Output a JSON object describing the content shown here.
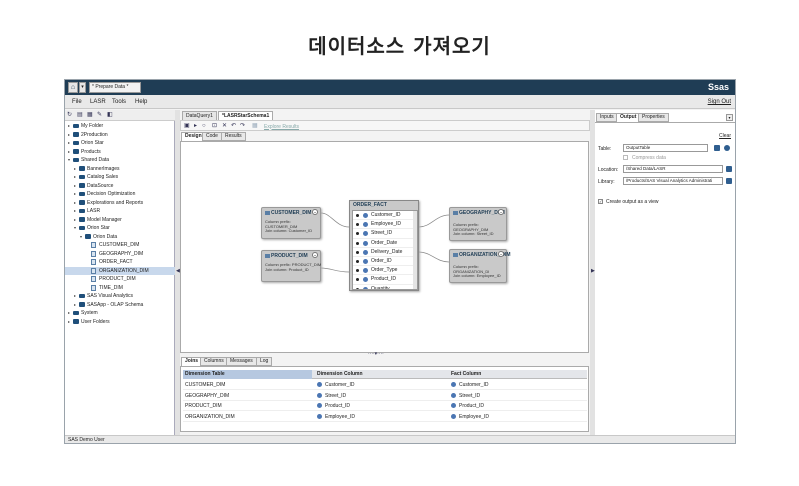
{
  "page_title": "데이터소스 가져오기",
  "topbar": {
    "app_selector": "* Prepare Data *",
    "brand": "Ssas"
  },
  "menu": {
    "items": [
      "File",
      "LASR",
      "Tools",
      "Help"
    ],
    "sign_out": "Sign Out"
  },
  "left_panel": {
    "tree": [
      {
        "label": "My Folder",
        "level": 0,
        "type": "folder",
        "expanded": false
      },
      {
        "label": "2Production",
        "level": 0,
        "type": "folder",
        "expanded": false
      },
      {
        "label": "Orion Star",
        "level": 0,
        "type": "folder",
        "expanded": false
      },
      {
        "label": "Products",
        "level": 0,
        "type": "folder",
        "expanded": false
      },
      {
        "label": "Shared Data",
        "level": 0,
        "type": "folder",
        "expanded": true
      },
      {
        "label": "BannerImages",
        "level": 1,
        "type": "folder",
        "expanded": false
      },
      {
        "label": "Catalog Sales",
        "level": 1,
        "type": "folder",
        "expanded": false
      },
      {
        "label": "DataSource",
        "level": 1,
        "type": "folder",
        "expanded": false
      },
      {
        "label": "Decision Optimization",
        "level": 1,
        "type": "folder",
        "expanded": false
      },
      {
        "label": "Explorations and Reports",
        "level": 1,
        "type": "folder",
        "expanded": false
      },
      {
        "label": "LASR",
        "level": 1,
        "type": "folder",
        "expanded": false
      },
      {
        "label": "Model Manager",
        "level": 1,
        "type": "folder",
        "expanded": false
      },
      {
        "label": "Orion Star",
        "level": 1,
        "type": "folder",
        "expanded": true
      },
      {
        "label": "Orion Data",
        "level": 2,
        "type": "folder",
        "expanded": true
      },
      {
        "label": "CUSTOMER_DIM",
        "level": 3,
        "type": "table"
      },
      {
        "label": "GEOGRAPHY_DIM",
        "level": 3,
        "type": "table"
      },
      {
        "label": "ORDER_FACT",
        "level": 3,
        "type": "table"
      },
      {
        "label": "ORGANIZATION_DIM",
        "level": 3,
        "type": "table",
        "selected": true
      },
      {
        "label": "PRODUCT_DIM",
        "level": 3,
        "type": "table"
      },
      {
        "label": "TIME_DIM",
        "level": 3,
        "type": "table"
      },
      {
        "label": "SAS Visual Analytics",
        "level": 1,
        "type": "folder",
        "expanded": false
      },
      {
        "label": "SASApp - OLAP Schema",
        "level": 1,
        "type": "folder",
        "expanded": false
      },
      {
        "label": "System",
        "level": 0,
        "type": "folder",
        "expanded": false
      },
      {
        "label": "User Folders",
        "level": 0,
        "type": "folder",
        "expanded": false
      }
    ]
  },
  "center": {
    "doc_tabs": [
      "DataQuery1",
      "*LASRStarSchema1"
    ],
    "explore_link": "Explore Results",
    "view_tabs": [
      "Design",
      "Code",
      "Results"
    ],
    "dimension_tables": [
      {
        "id": "customer",
        "title": "CUSTOMER_DIM",
        "prefix": "Column prefix:",
        "prefix_value": "CUSTOMER_DIM",
        "join_label": "Join column: Customer_ID"
      },
      {
        "id": "product",
        "title": "PRODUCT_DIM",
        "prefix": "Column prefix: PRODUCT_DIM",
        "prefix_value": "",
        "join_label": "Join column: Product_ID"
      },
      {
        "id": "geography",
        "title": "GEOGRAPHY_DI M",
        "prefix": "Column prefix:",
        "prefix_value": "GEOGRAPHY_DIM",
        "join_label": "Join column: Street_ID"
      },
      {
        "id": "organization",
        "title": "ORGANIZATION_ DIM",
        "prefix": "Column prefix:",
        "prefix_value": "ORGANIZATION_DI",
        "join_label": "Join column: Employee_ID"
      }
    ],
    "fact_table": {
      "title": "ORDER_FACT",
      "columns": [
        "Customer_ID",
        "Employee_ID",
        "Street_ID",
        "Order_Date",
        "Delivery_Date",
        "Order_ID",
        "Order_Type",
        "Product_ID",
        "Quantity"
      ]
    },
    "bottom_tabs": [
      "Joins",
      "Columns",
      "Messages",
      "Log"
    ],
    "joins": {
      "headers": [
        "Dimension Table",
        "Dimension Column",
        "Fact Column"
      ],
      "rows": [
        [
          "CUSTOMER_DIM",
          "Customer_ID",
          "Customer_ID"
        ],
        [
          "GEOGRAPHY_DIM",
          "Street_ID",
          "Street_ID"
        ],
        [
          "PRODUCT_DIM",
          "Product_ID",
          "Product_ID"
        ],
        [
          "ORGANIZATION_DIM",
          "Employee_ID",
          "Employee_ID"
        ]
      ]
    }
  },
  "right_panel": {
    "tabs": [
      "Inputs",
      "Output",
      "Properties"
    ],
    "clear": "Clear",
    "table_label": "Table:",
    "table_value": "OutputTable",
    "compress_label": "Compress data",
    "location_label": "Location:",
    "location_value": "/Shared Data/LASR",
    "library_label": "Library:",
    "library_value": "/Products/SAS Visual Analytics Administrati",
    "create_view_label": "Create output as a view"
  },
  "status": {
    "user": "SAS Demo User"
  }
}
